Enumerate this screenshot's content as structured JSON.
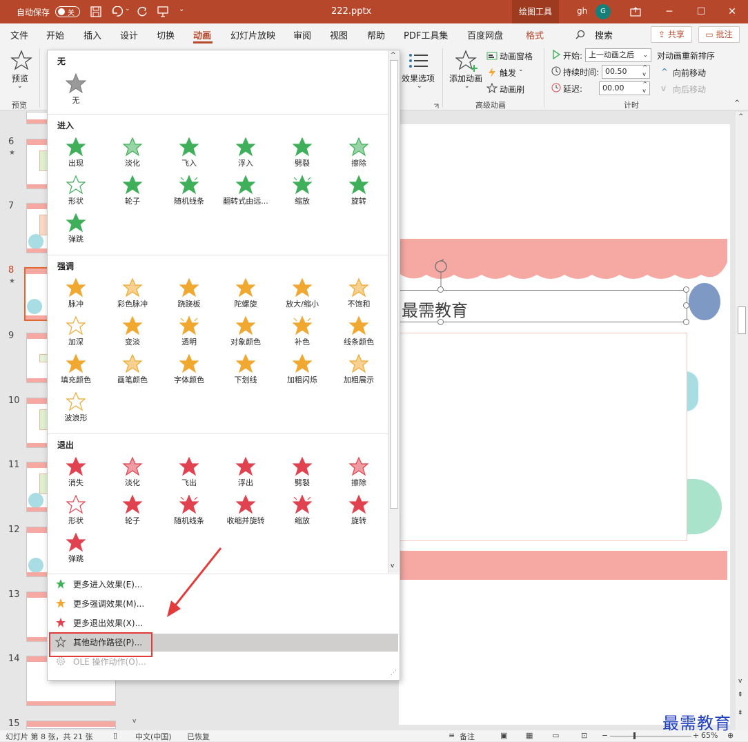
{
  "titlebar": {
    "autosave_label": "自动保存",
    "autosave_state": "关",
    "filename": "222.pptx",
    "context_tab": "绘图工具",
    "user": "gh",
    "avatar_initial": "G"
  },
  "tabs": [
    "文件",
    "开始",
    "插入",
    "设计",
    "切换",
    "动画",
    "幻灯片放映",
    "审阅",
    "视图",
    "帮助",
    "PDF工具集",
    "百度网盘",
    "格式"
  ],
  "active_tab": "动画",
  "search_label": "搜索",
  "share_label": "共享",
  "comment_label": "批注",
  "ribbon": {
    "preview_label": "预览",
    "preview_group": "预览",
    "effect_options": "效果选项",
    "add_animation": "添加动画",
    "animation_pane": "动画窗格",
    "trigger": "触发",
    "animation_painter": "动画刷",
    "advanced_group": "高级动画",
    "start_label": "开始:",
    "start_value": "上一动画之后",
    "duration_label": "持续时间:",
    "duration_value": "00.50",
    "delay_label": "延迟:",
    "delay_value": "00.00",
    "reorder_label": "对动画重新排序",
    "move_earlier": "向前移动",
    "move_later": "向后移动",
    "timing_group": "计时"
  },
  "gallery": {
    "none_section": "无",
    "none_item": "无",
    "entrance_section": "进入",
    "entrance": [
      "出现",
      "淡化",
      "飞入",
      "浮入",
      "劈裂",
      "擦除",
      "形状",
      "轮子",
      "随机线条",
      "翻转式由远...",
      "缩放",
      "旋转",
      "弹跳"
    ],
    "emphasis_section": "强调",
    "emphasis": [
      "脉冲",
      "彩色脉冲",
      "跷跷板",
      "陀螺旋",
      "放大/缩小",
      "不饱和",
      "加深",
      "变淡",
      "透明",
      "对象颜色",
      "补色",
      "线条颜色",
      "填充颜色",
      "画笔颜色",
      "字体颜色",
      "下划线",
      "加粗闪烁",
      "加粗展示",
      "波浪形"
    ],
    "exit_section": "退出",
    "exit": [
      "消失",
      "淡化",
      "飞出",
      "浮出",
      "劈裂",
      "擦除",
      "形状",
      "轮子",
      "随机线条",
      "收缩并旋转",
      "缩放",
      "旋转",
      "弹跳"
    ],
    "more_entrance": "更多进入效果(E)...",
    "more_emphasis": "更多强调效果(M)...",
    "more_exit": "更多退出效果(X)...",
    "motion_paths": "其他动作路径(P)...",
    "ole_actions": "OLE 操作动作(O)..."
  },
  "slides": [
    "6",
    "7",
    "8",
    "9",
    "10",
    "11",
    "12",
    "13",
    "14",
    "15"
  ],
  "current_slide": "8",
  "slide_title": "最需教育",
  "statusbar": {
    "slide_info": "幻灯片 第 8 张，共 21 张",
    "language": "中文(中国)",
    "recovered": "已恢复",
    "notes": "备注",
    "zoom": "65%"
  },
  "watermark": "最需教育",
  "colors": {
    "brand": "#b7472a",
    "entrance": "#3faf5a",
    "emphasis": "#f0a830",
    "exit": "#e0434f",
    "highlight_box": "#e23b3b"
  }
}
